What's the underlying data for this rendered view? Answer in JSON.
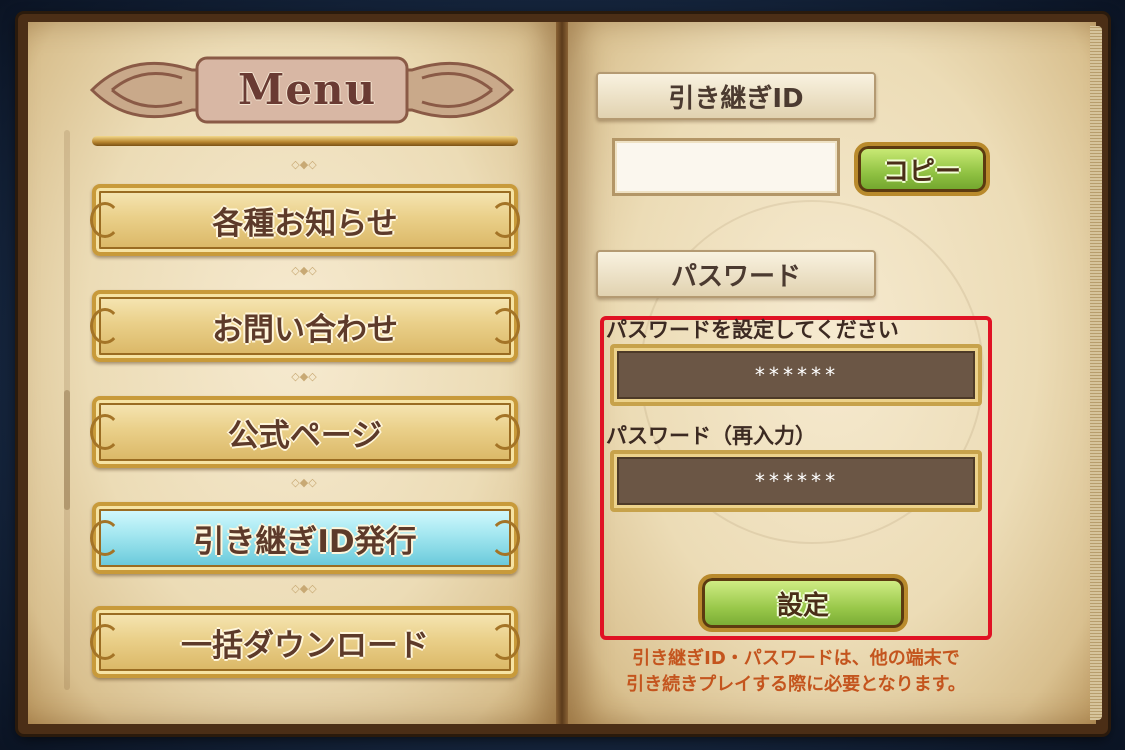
{
  "menu": {
    "title": "Menu",
    "items": [
      {
        "label": "各種お知らせ",
        "active": false
      },
      {
        "label": "お問い合わせ",
        "active": false
      },
      {
        "label": "公式ページ",
        "active": false
      },
      {
        "label": "引き継ぎID発行",
        "active": true
      },
      {
        "label": "一括ダウンロード",
        "active": false
      }
    ]
  },
  "transfer": {
    "id_heading": "引き継ぎID",
    "id_value": "",
    "copy_label": "コピー",
    "password_heading": "パスワード",
    "password_label": "パスワードを設定してください",
    "password_value": "******",
    "confirm_label": "パスワード（再入力）",
    "confirm_value": "******",
    "set_label": "設定",
    "note_line1": "引き継ぎID・パスワードは、他の端末で",
    "note_line2": "引き続きプレイする際に必要となります。"
  },
  "colors": {
    "highlight_box": "#e01224",
    "active_menu": "#a3e7f0",
    "note_text": "#c4551e",
    "button_green": "#99c84a"
  }
}
